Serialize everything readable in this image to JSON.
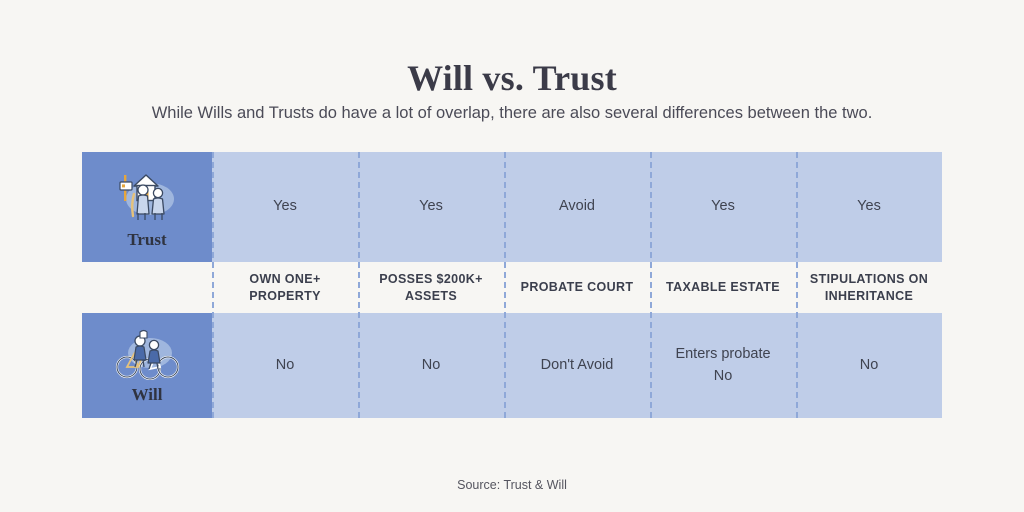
{
  "header": {
    "title": "Will vs. Trust",
    "subtitle": "While Wills and Trusts do have a lot of overlap, there are also several differences between the two."
  },
  "colors": {
    "background": "#f7f6f3",
    "row_label_blue": "#6e8ccb",
    "cell_blue": "#bfcde8",
    "divider_blue": "#8fa8d8",
    "text_dark": "#3b3b48"
  },
  "table": {
    "column_headers": [
      "OWN ONE+ PROPERTY",
      "POSSES $200K+ ASSETS",
      "PROBATE COURT",
      "TAXABLE ESTATE",
      "STIPULATIONS ON INHERITANCE"
    ],
    "rows": [
      {
        "label": "Trust",
        "icon": "elderly-couple-house-icon",
        "values": [
          "Yes",
          "Yes",
          "Avoid",
          "Yes",
          "Yes"
        ]
      },
      {
        "label": "Will",
        "icon": "couple-on-bicycles-icon",
        "values": [
          "No",
          "No",
          "Don't Avoid",
          "Enters probate\nNo",
          "No"
        ]
      }
    ]
  },
  "footer": {
    "source": "Source: Trust & Will"
  }
}
